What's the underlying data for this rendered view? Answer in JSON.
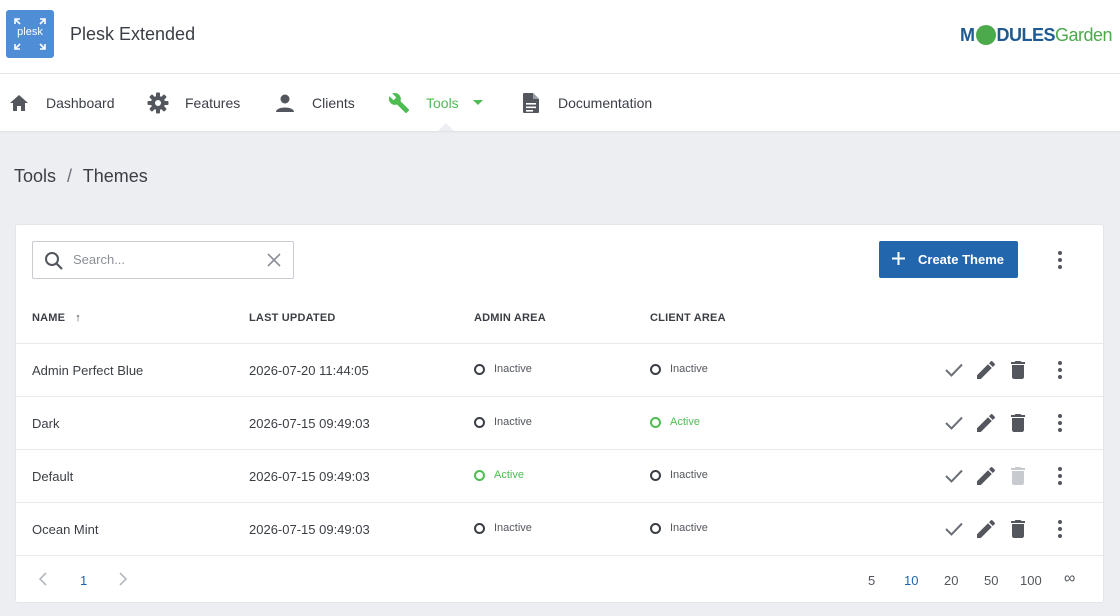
{
  "app": {
    "title": "Plesk Extended",
    "logo_text": "plesk",
    "brand": "MODULESGarden"
  },
  "brand_parts": {
    "m": "M",
    "dules": "DULES",
    "garden": "Garden"
  },
  "nav": {
    "items": [
      {
        "label": "Dashboard",
        "icon": "home-icon"
      },
      {
        "label": "Features",
        "icon": "gear-icon"
      },
      {
        "label": "Clients",
        "icon": "user-icon"
      },
      {
        "label": "Tools",
        "icon": "wrench-icon",
        "active": true
      },
      {
        "label": "Documentation",
        "icon": "document-icon"
      }
    ]
  },
  "breadcrumb": {
    "parent": "Tools",
    "separator": "/",
    "current": "Themes"
  },
  "search": {
    "placeholder": "Search...",
    "value": ""
  },
  "toolbar": {
    "create_label": "Create Theme"
  },
  "table": {
    "headers": {
      "name": "NAME",
      "updated": "LAST UPDATED",
      "admin": "ADMIN AREA",
      "client": "CLIENT AREA"
    },
    "sort_indicator": "↑",
    "rows": [
      {
        "name": "Admin Perfect Blue",
        "updated": "2026-07-20 11:44:05",
        "admin": "Inactive",
        "client": "Inactive"
      },
      {
        "name": "Dark",
        "updated": "2026-07-15 09:49:03",
        "admin": "Inactive",
        "client": "Active"
      },
      {
        "name": "Default",
        "updated": "2026-07-15 09:49:03",
        "admin": "Active",
        "client": "Inactive"
      },
      {
        "name": "Ocean Mint",
        "updated": "2026-07-15 09:49:03",
        "admin": "Inactive",
        "client": "Inactive"
      }
    ]
  },
  "pagination": {
    "current_page": "1",
    "page_sizes": [
      "5",
      "10",
      "20",
      "50",
      "100",
      "∞"
    ],
    "selected_size": "10"
  },
  "colors": {
    "accent_green": "#4dbd52",
    "primary_blue": "#2266ad",
    "brand_blue": "#1f5a91"
  }
}
